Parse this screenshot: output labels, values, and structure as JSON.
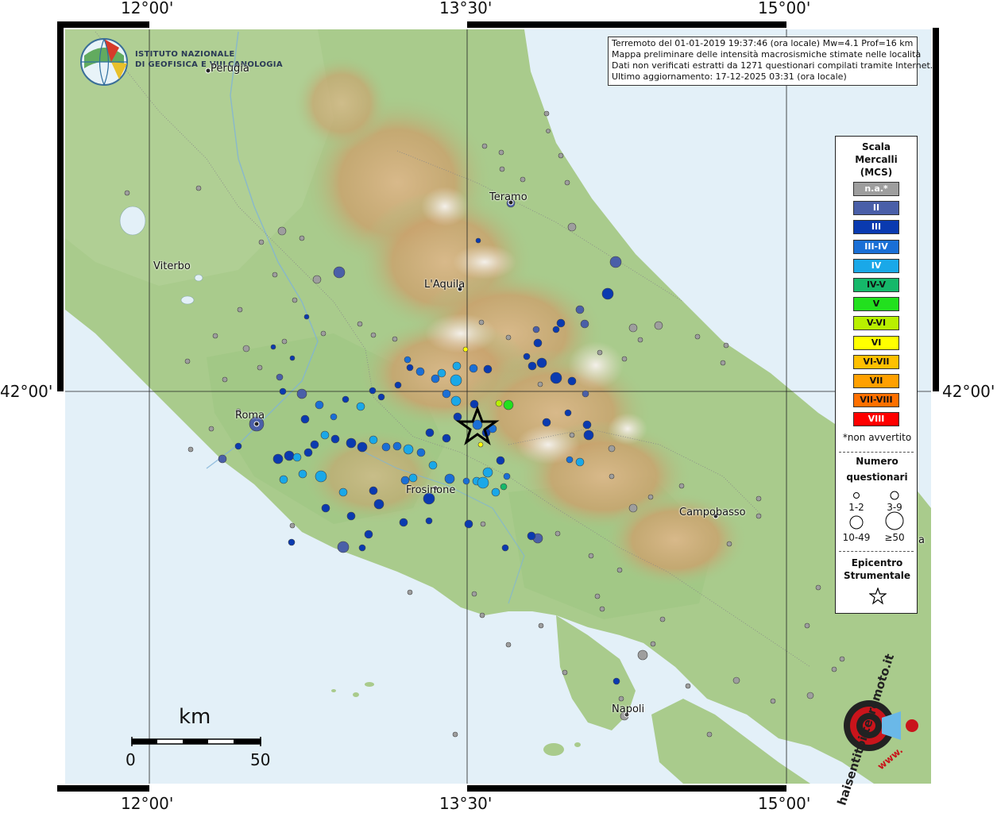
{
  "graticule": {
    "top_labels": [
      "12°00'",
      "13°30'",
      "15°00'"
    ],
    "bottom_labels": [
      "12°00'",
      "13°30'",
      "15°00'"
    ],
    "left_label": "42°00'",
    "right_label": "42°00'"
  },
  "logo": {
    "line1": "ISTITUTO NAZIONALE",
    "line2": "DI GEOFISICA E VULCANOLOGIA"
  },
  "info": {
    "line1": "Terremoto del 01-01-2019 19:37:46 (ora locale) Mw=4.1 Prof=16 km",
    "line2": "Mappa preliminare delle intensità macrosismiche stimate nelle località",
    "line3": "Dati non verificati estratti da 1271 questionari compilati tramite Internet.",
    "line4": "Ultimo aggiornamento: 17-12-2025 03:31 (ora locale)"
  },
  "cities": {
    "perugia": "Perugia",
    "teramo": "Teramo",
    "viterbo": "Viterbo",
    "laquila": "L'Aquila",
    "roma": "Roma",
    "frosinone": "Frosinone",
    "campobasso": "Campobasso",
    "napoli": "Napoli",
    "partial": "a"
  },
  "legend": {
    "title1": "Scala",
    "title2": "Mercalli",
    "title3": "(MCS)",
    "classes": [
      {
        "label": "n.a.*",
        "color": "#9e9e9e",
        "text_color": "#ffffff"
      },
      {
        "label": "II",
        "color": "#4a5fa8",
        "text_color": "#ffffff"
      },
      {
        "label": "III",
        "color": "#0a3ab0",
        "text_color": "#ffffff"
      },
      {
        "label": "III-IV",
        "color": "#1a6fd6",
        "text_color": "#ffffff"
      },
      {
        "label": "IV",
        "color": "#1aa8e8",
        "text_color": "#ffffff"
      },
      {
        "label": "IV-V",
        "color": "#15b86a",
        "text_color": "#111111"
      },
      {
        "label": "V",
        "color": "#22e01e",
        "text_color": "#111111"
      },
      {
        "label": "V-VI",
        "color": "#b8f000",
        "text_color": "#111111"
      },
      {
        "label": "VI",
        "color": "#ffff00",
        "text_color": "#111111"
      },
      {
        "label": "VI-VII",
        "color": "#ffc000",
        "text_color": "#111111"
      },
      {
        "label": "VII",
        "color": "#ffa000",
        "text_color": "#111111"
      },
      {
        "label": "VII-VIII",
        "color": "#ff7000",
        "text_color": "#111111"
      },
      {
        "label": "VIII",
        "color": "#ff0000",
        "text_color": "#ffffff"
      }
    ],
    "not_felt_note": "*non avvertito",
    "count_title1": "Numero",
    "count_title2": "questionari",
    "count_sizes": [
      "1-2",
      "3-9",
      "10-49",
      "≥50"
    ],
    "epicenter_title1": "Epicentro",
    "epicenter_title2": "Strumentale"
  },
  "scalebar": {
    "unit": "km",
    "min_label": "0",
    "max_label": "50"
  },
  "watermark": {
    "text": "haisentitoilterremoto.it",
    "url": "www."
  }
}
